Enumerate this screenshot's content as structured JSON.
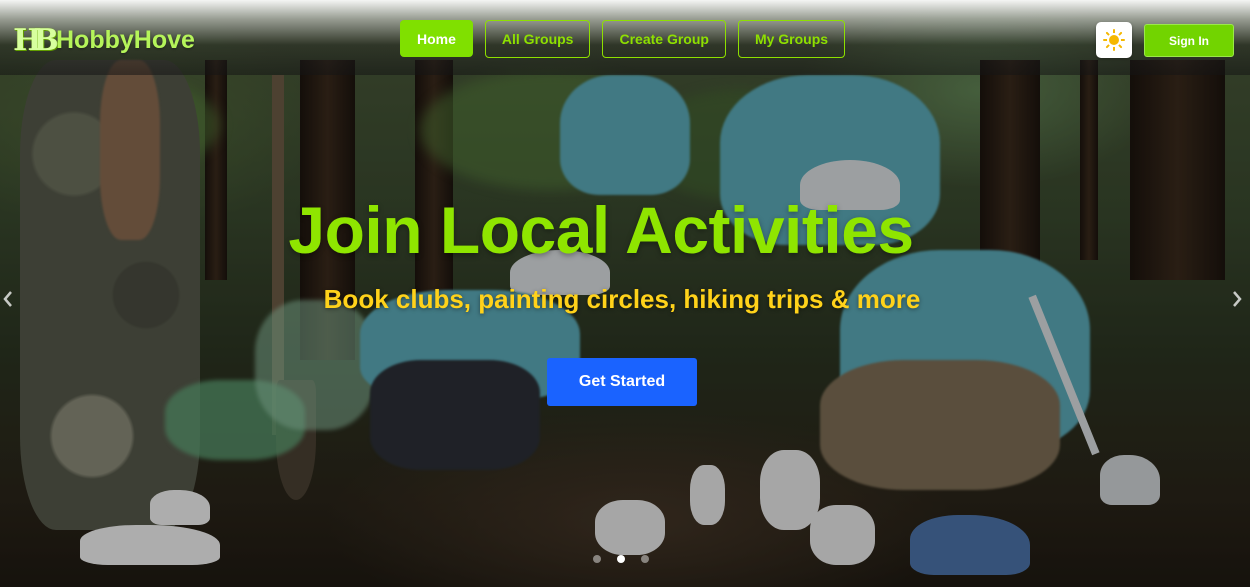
{
  "brand": {
    "logo_text": "HB",
    "name": "HobbyHove"
  },
  "nav": {
    "links": [
      {
        "label": "Home",
        "active": true
      },
      {
        "label": "All Groups",
        "active": false
      },
      {
        "label": "Create Group",
        "active": false
      },
      {
        "label": "My Groups",
        "active": false
      }
    ]
  },
  "header": {
    "theme_toggle_icon": "sun-icon",
    "signin_label": "Sign In"
  },
  "hero": {
    "title": "Join Local Activities",
    "subtitle": "Book clubs, painting circles, hiking trips & more",
    "cta_label": "Get Started"
  },
  "carousel": {
    "slide_count": 3,
    "active_index": 1,
    "prev_icon": "chevron-left-icon",
    "next_icon": "chevron-right-icon"
  },
  "colors": {
    "accent_green": "#80e000",
    "title_green": "#8fe500",
    "subtitle_yellow": "#ffd21a",
    "cta_blue": "#1a63ff"
  }
}
